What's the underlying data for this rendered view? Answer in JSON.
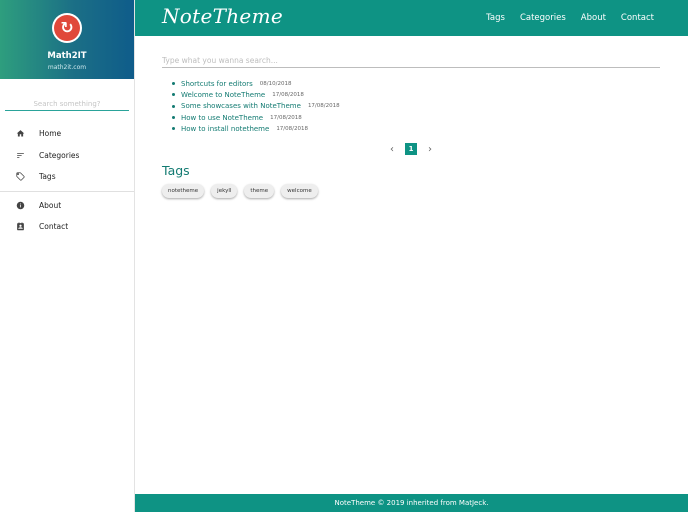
{
  "sidebar": {
    "site_name": "Math2IT",
    "site_url": "math2it.com",
    "search_placeholder": "Search something?",
    "items": [
      {
        "label": "Home",
        "icon": "home-icon"
      },
      {
        "label": "Categories",
        "icon": "sort-icon"
      },
      {
        "label": "Tags",
        "icon": "tag-icon"
      }
    ],
    "items2": [
      {
        "label": "About",
        "icon": "info-icon"
      },
      {
        "label": "Contact",
        "icon": "contact-icon"
      }
    ]
  },
  "topbar": {
    "brand": "NoteTheme",
    "nav": [
      "Tags",
      "Categories",
      "About",
      "Contact"
    ]
  },
  "main": {
    "search_placeholder": "Type what you wanna search...",
    "posts": [
      {
        "title": "Shortcuts for editors",
        "date": "08/10/2018"
      },
      {
        "title": "Welcome to NoteTheme",
        "date": "17/08/2018"
      },
      {
        "title": "Some showcases with NoteTheme",
        "date": "17/08/2018"
      },
      {
        "title": "How to use NoteTheme",
        "date": "17/08/2018"
      },
      {
        "title": "How to install notetheme",
        "date": "17/08/2018"
      }
    ],
    "pager": {
      "prev": "‹",
      "current": "1",
      "next": "›"
    },
    "tags_title": "Tags",
    "tags": [
      "notetheme",
      "jekyll",
      "theme",
      "welcome"
    ]
  },
  "footer": {
    "text": "NoteTheme © 2019 inherited from MatJeck."
  },
  "colors": {
    "accent": "#0e9384",
    "link": "#137b72",
    "avatar": "#e0483a"
  }
}
